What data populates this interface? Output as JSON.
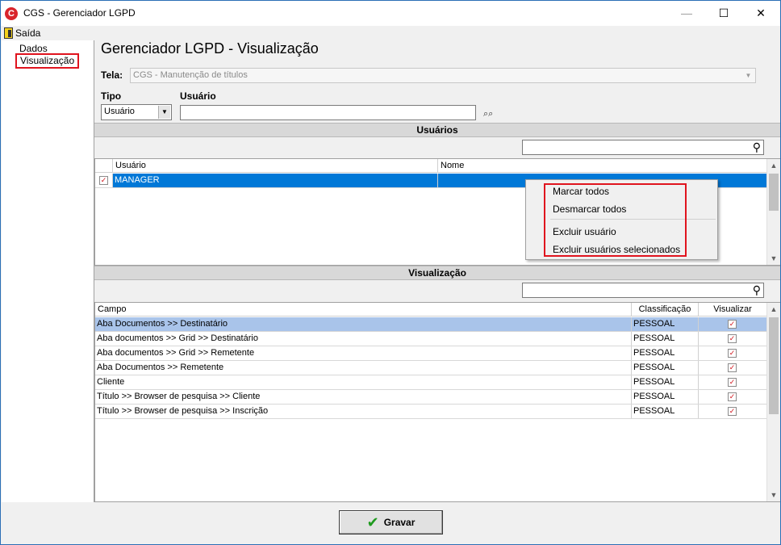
{
  "window": {
    "app_icon": "C",
    "title": "CGS - Gerenciador LGPD",
    "controls": {
      "minimize": "—",
      "maximize": "☐",
      "close": "✕"
    }
  },
  "menu": {
    "exit_label": "Saída"
  },
  "tree": {
    "items": [
      "Dados",
      "Visualização"
    ],
    "selected": "Visualização"
  },
  "page": {
    "title": "Gerenciador LGPD - Visualização"
  },
  "form": {
    "tela_label": "Tela:",
    "tela_value": "CGS - Manutenção de títulos",
    "tipo_label": "Tipo",
    "tipo_value": "Usuário",
    "usuario_label": "Usuário",
    "usuario_value": ""
  },
  "users_section": {
    "title": "Usuários",
    "columns": [
      "Usuário",
      "Nome"
    ],
    "rows": [
      {
        "checked": true,
        "usuario": "MANAGER",
        "nome": ""
      }
    ]
  },
  "context_menu": {
    "items": [
      "Marcar todos",
      "Desmarcar todos",
      "Excluir usuário",
      "Excluir usuários selecionados"
    ]
  },
  "view_section": {
    "title": "Visualização",
    "columns": [
      "Campo",
      "Classificação",
      "Visualizar"
    ],
    "rows": [
      {
        "campo": "Aba Documentos >> Destinatário",
        "classificacao": "PESSOAL",
        "visualizar": true
      },
      {
        "campo": "Aba documentos >> Grid  >> Destinatário",
        "classificacao": "PESSOAL",
        "visualizar": true
      },
      {
        "campo": "Aba documentos >> Grid  >> Remetente",
        "classificacao": "PESSOAL",
        "visualizar": true
      },
      {
        "campo": "Aba Documentos >> Remetente",
        "classificacao": "PESSOAL",
        "visualizar": true
      },
      {
        "campo": "Cliente",
        "classificacao": "PESSOAL",
        "visualizar": true
      },
      {
        "campo": "Título >> Browser de pesquisa >> Cliente",
        "classificacao": "PESSOAL",
        "visualizar": true
      },
      {
        "campo": "Título >> Browser de pesquisa >> Inscrição",
        "classificacao": "PESSOAL",
        "visualizar": true
      }
    ]
  },
  "actions": {
    "save_label": "Gravar"
  },
  "colors": {
    "selection": "#0078d7",
    "highlight_row": "#a9c4ea",
    "annotation_red": "#e0141e",
    "check_red": "#d0121a"
  }
}
